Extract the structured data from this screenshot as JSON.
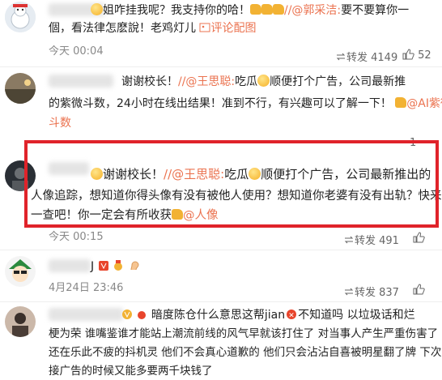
{
  "comments": [
    {
      "line1": "姐咋挂我呢？我支持你的哈！",
      "mention": "//@郭采洁:",
      "line1_after": "要不要算你一",
      "line2": "個，看法律怎麽說！老鸡灯儿",
      "link": "评论配图",
      "time": "今天 00:04",
      "repost": "转发 4149",
      "likes": "52"
    },
    {
      "line1_prefix": "谢谢校长！",
      "mention": "//@王思聪:",
      "line1_after": "吃瓜",
      "line1_rest": "顺便打个广告，公司最新推",
      "line2": "的紫微斗数，24小时在线出结果！准到不行，有兴趣可以了解一下！",
      "mention2": "@AI紫微",
      "line3": "斗数",
      "likes": "1"
    },
    {
      "line1_prefix": "谢谢校长！",
      "mention": "//@王思聪:",
      "line1_after": "吃瓜",
      "line1_rest": "顺便打个广告，公司最新推出的",
      "line2": "人像追踪，想知道你得头像有没有被他人使用？想知道你老婆有没有出轨？快来查",
      "line3": "一查吧！你一定会有所收获",
      "mention2": "@人像",
      "time": "今天 00:15",
      "repost": "转发 491",
      "likes": "1"
    },
    {
      "name_tail": "J",
      "time": "4月24日 23:46",
      "repost": "转发 837"
    },
    {
      "line1": "暗度陈仓什么意思这帮jian",
      "line1_after": "不知道吗 以垃圾话和烂",
      "line2": "梗为荣 谁嘴鉴谁才能站上潮流前线的风气早就该打住了 对当事人产生严重伤害了",
      "line3": "还在乐此不疲的抖机灵 他们不会真心道歉的 他们只会沾沾自喜被明星翻了牌 下次",
      "line4": "接广告的时候又能多要两千块钱了"
    }
  ]
}
